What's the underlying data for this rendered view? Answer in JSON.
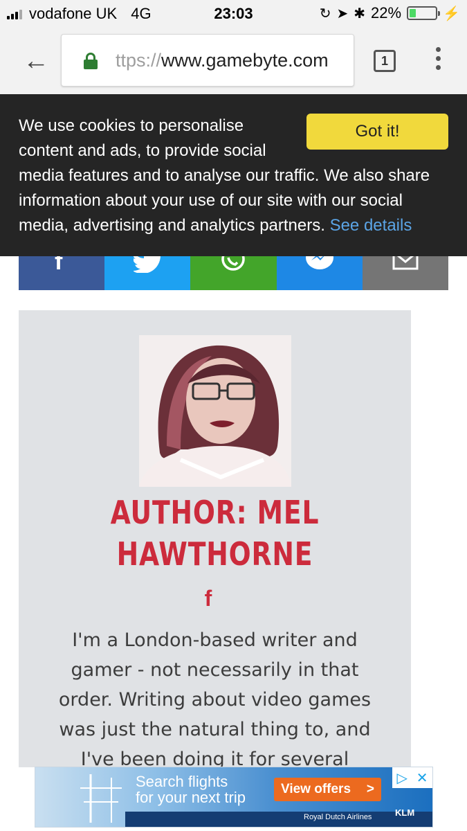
{
  "status_bar": {
    "carrier": "vodafone UK",
    "network": "4G",
    "time": "23:03",
    "battery": "22%",
    "battery_level": 0.22
  },
  "browser": {
    "url_protocol": "ttps://",
    "url_host": "www.gamebyte.com",
    "tab_count": "1"
  },
  "cookie_banner": {
    "text": "We use cookies to personalise content and ads, to provide social media features and to analyse our traffic. We also share information about your use of our site with our social media, advertising and analytics partners.",
    "details_link": "See details",
    "accept_button": "Got it!"
  },
  "share_bar": {
    "buttons": [
      "facebook",
      "twitter",
      "whatsapp",
      "messenger",
      "email"
    ],
    "colors": {
      "facebook": "#3b5998",
      "twitter": "#1da1f2",
      "whatsapp": "#43a52a",
      "messenger": "#1e88e5",
      "email": "#757575"
    }
  },
  "author": {
    "title": "AUTHOR: MEL HAWTHORNE",
    "social_icon": "f",
    "bio": "I'm a London-based writer and gamer - not necessarily in that order. Writing about video games was just the natural thing to, and I've been doing it for several",
    "accent_color": "#cc2b3c"
  },
  "ad": {
    "headline_1": "Search flights",
    "headline_2": "for your next trip",
    "cta": "View offers",
    "cta_arrow": ">",
    "sponsor": "Royal Dutch Airlines",
    "brand": "KLM"
  }
}
